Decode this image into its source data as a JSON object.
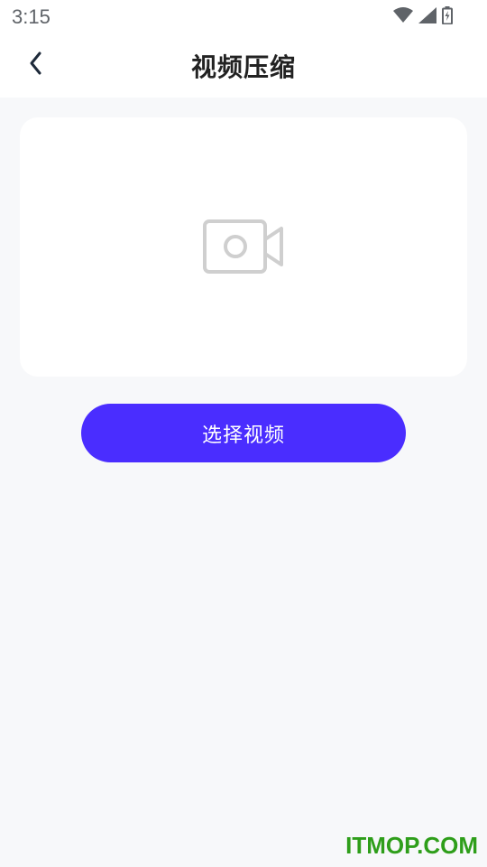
{
  "status_bar": {
    "time": "3:15",
    "icons": [
      "wifi-icon",
      "signal-icon",
      "battery-charging-icon"
    ]
  },
  "header": {
    "back_icon": "chevron-left-icon",
    "title": "视频压缩"
  },
  "preview": {
    "placeholder_icon": "video-camera-icon"
  },
  "actions": {
    "select_video_label": "选择视频"
  },
  "watermark": {
    "text": "ITMOP.COM"
  },
  "colors": {
    "accent": "#4a2dff",
    "background": "#f7f8fa",
    "watermark": "#2e9e1a"
  }
}
